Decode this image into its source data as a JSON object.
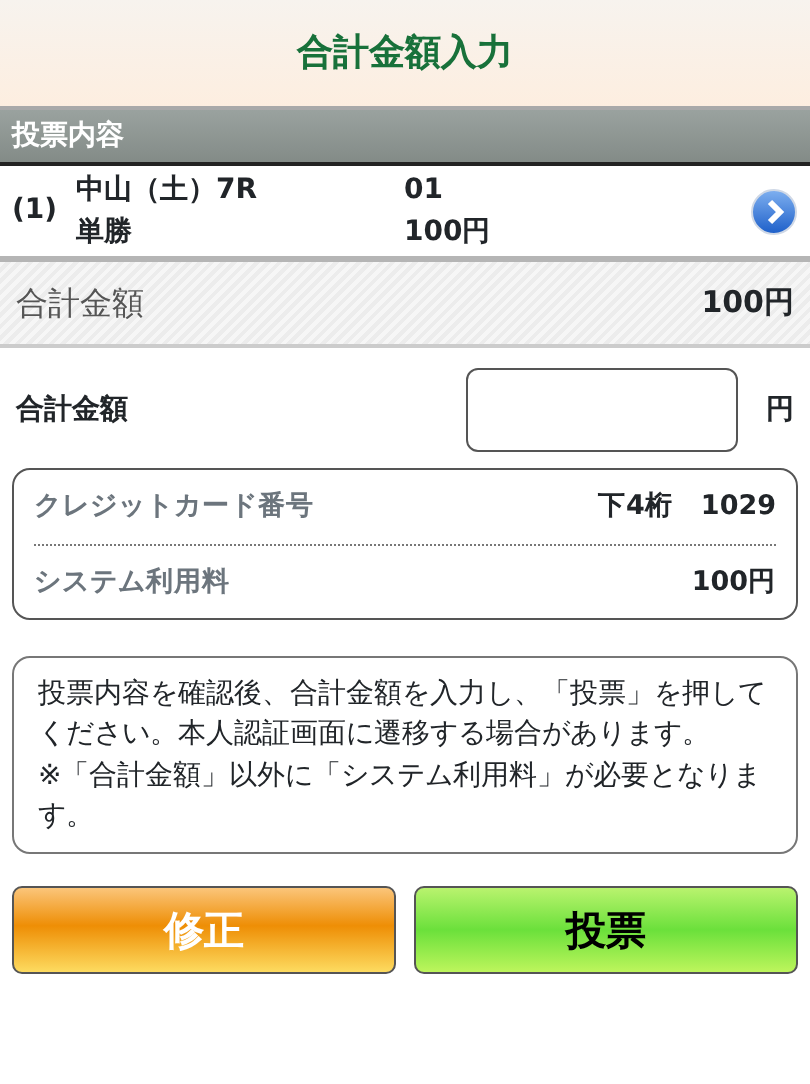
{
  "header": {
    "title": "合計金額入力"
  },
  "section": {
    "title": "投票内容"
  },
  "bets": [
    {
      "number": "(1)",
      "race": "中山（土）7R",
      "type": "単勝",
      "selection": "01",
      "amount": "100円"
    }
  ],
  "total": {
    "label": "合計金額",
    "value": "100円"
  },
  "input": {
    "label": "合計金額",
    "unit": "円"
  },
  "info": [
    {
      "label": "クレジットカード番号",
      "prefix": "下4桁",
      "value": "1029"
    },
    {
      "label": "システム利用料",
      "value": "100円"
    }
  ],
  "note": [
    "投票内容を確認後、合計金額を入力し、「投票」を押してください。本人認証画面に遷移する場合があります。",
    "※「合計金額」以外に「システム利用料」が必要となります。"
  ],
  "buttons": [
    {
      "label": "修正",
      "kind": "secondary"
    },
    {
      "label": "投票",
      "kind": "primary"
    }
  ]
}
